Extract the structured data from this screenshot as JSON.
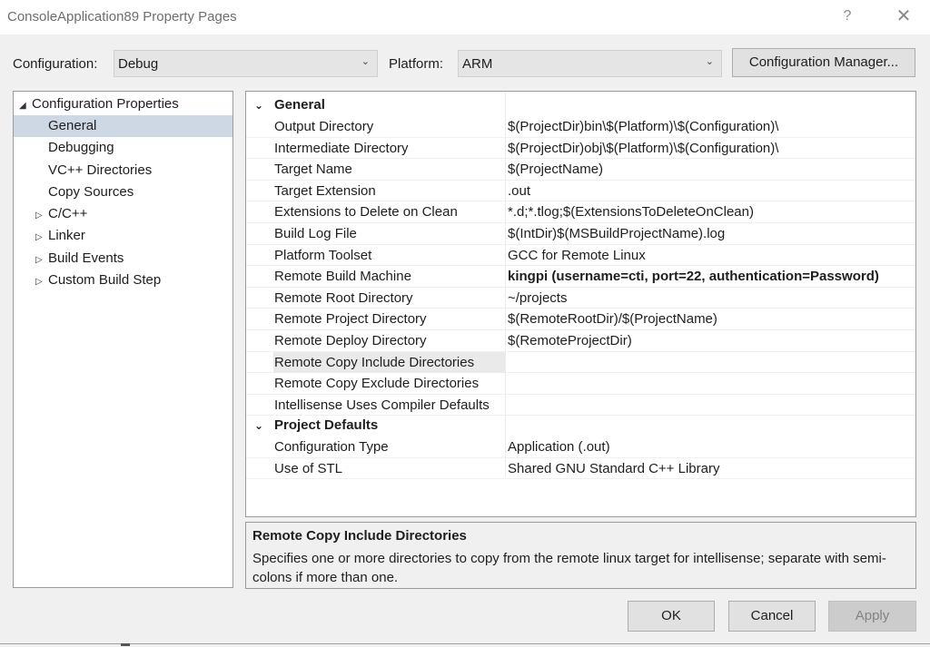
{
  "window": {
    "title": "ConsoleApplication89 Property Pages",
    "help_glyph": "?",
    "close_glyph": "✕"
  },
  "toolbar": {
    "configuration_label": "Configuration:",
    "configuration_value": "Debug",
    "platform_label": "Platform:",
    "platform_value": "ARM",
    "dropdown_glyph": "⌄",
    "config_manager_label": "Configuration Manager..."
  },
  "tree": {
    "root": {
      "label": "Configuration Properties",
      "toggle": "◢"
    },
    "items": [
      {
        "label": "General",
        "selected": true
      },
      {
        "label": "Debugging"
      },
      {
        "label": "VC++ Directories"
      },
      {
        "label": "Copy Sources"
      },
      {
        "label": "C/C++",
        "toggle": "▷"
      },
      {
        "label": "Linker",
        "toggle": "▷"
      },
      {
        "label": "Build Events",
        "toggle": "▷"
      },
      {
        "label": "Custom Build Step",
        "toggle": "▷"
      }
    ]
  },
  "grid": {
    "categories": [
      {
        "label": "General",
        "chevron": "⌄",
        "rows": [
          {
            "name": "Output Directory",
            "value": "$(ProjectDir)bin\\$(Platform)\\$(Configuration)\\"
          },
          {
            "name": "Intermediate Directory",
            "value": "$(ProjectDir)obj\\$(Platform)\\$(Configuration)\\"
          },
          {
            "name": "Target Name",
            "value": "$(ProjectName)"
          },
          {
            "name": "Target Extension",
            "value": ".out"
          },
          {
            "name": "Extensions to Delete on Clean",
            "value": "*.d;*.tlog;$(ExtensionsToDeleteOnClean)"
          },
          {
            "name": "Build Log File",
            "value": "$(IntDir)$(MSBuildProjectName).log"
          },
          {
            "name": "Platform Toolset",
            "value": "GCC for Remote Linux"
          },
          {
            "name": "Remote Build Machine",
            "value": "kingpi (username=cti, port=22, authentication=Password)",
            "bold": true
          },
          {
            "name": "Remote Root Directory",
            "value": "~/projects"
          },
          {
            "name": "Remote Project Directory",
            "value": "$(RemoteRootDir)/$(ProjectName)"
          },
          {
            "name": "Remote Deploy Directory",
            "value": "$(RemoteProjectDir)"
          },
          {
            "name": "Remote Copy Include Directories",
            "value": "",
            "highlighted": true
          },
          {
            "name": "Remote Copy Exclude Directories",
            "value": ""
          },
          {
            "name": "Intellisense Uses Compiler Defaults",
            "value": ""
          }
        ]
      },
      {
        "label": "Project Defaults",
        "chevron": "⌄",
        "rows": [
          {
            "name": "Configuration Type",
            "value": "Application (.out)"
          },
          {
            "name": "Use of STL",
            "value": "Shared GNU Standard C++ Library"
          }
        ]
      }
    ]
  },
  "description": {
    "title": "Remote Copy Include Directories",
    "text": "Specifies one or more directories to copy from the remote linux target for intellisense; separate with semi-colons if more than one."
  },
  "buttons": {
    "ok": "OK",
    "cancel": "Cancel",
    "apply": "Apply"
  }
}
